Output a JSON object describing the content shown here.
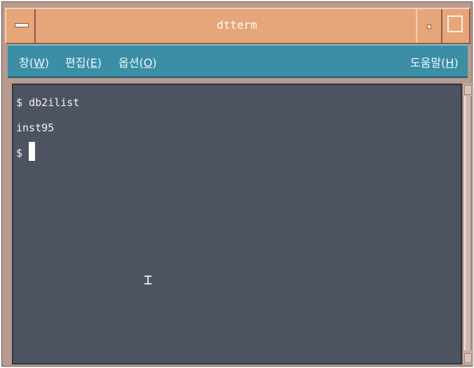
{
  "window": {
    "title": "dtterm"
  },
  "menu": {
    "items": [
      {
        "prefix": "창(",
        "mnemonic": "W",
        "suffix": ")"
      },
      {
        "prefix": "편집(",
        "mnemonic": "E",
        "suffix": ")"
      },
      {
        "prefix": "옵션(",
        "mnemonic": "O",
        "suffix": ")"
      }
    ],
    "help": {
      "prefix": "도움말(",
      "mnemonic": "H",
      "suffix": ")"
    }
  },
  "terminal": {
    "lines": [
      "$ db2ilist",
      "inst95",
      "$ "
    ]
  },
  "icons": {
    "window_menu": "window-menu-icon",
    "minimize": "minimize-icon",
    "maximize": "maximize-icon",
    "text_cursor": "ibeam-cursor-icon"
  },
  "colors": {
    "titlebar": "#e7a57a",
    "menubar": "#3b8ea6",
    "terminal_background": "#4d5360",
    "terminal_text": "#f3f4f6",
    "frame": "#b89b8e"
  }
}
